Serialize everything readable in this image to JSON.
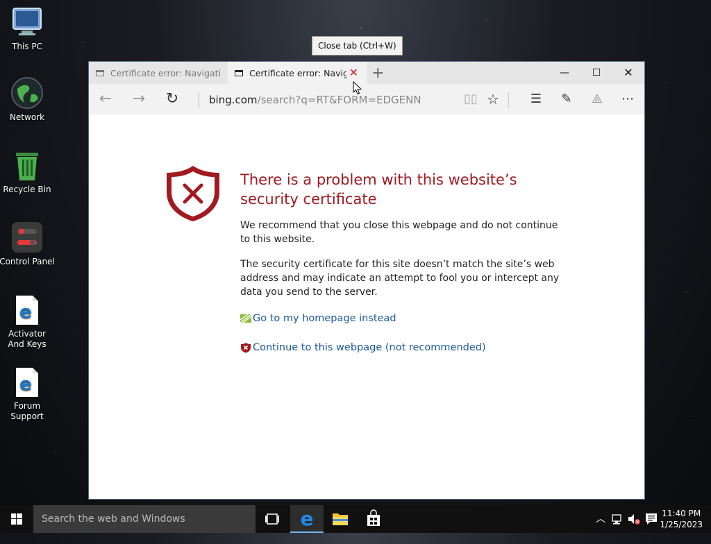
{
  "desktop": {
    "icons": [
      {
        "label": "This PC"
      },
      {
        "label": "Network"
      },
      {
        "label": "Recycle Bin"
      },
      {
        "label": "Control Panel"
      },
      {
        "label": "Activator And Keys"
      },
      {
        "label": "Forum Support"
      }
    ]
  },
  "tooltip": "Close tab (Ctrl+W)",
  "browser": {
    "tabs": [
      {
        "title": "Certificate error: Navigation blocked",
        "active": false
      },
      {
        "title": "Certificate error: Navigation blocked",
        "active": true
      }
    ],
    "address": {
      "domain": "bing.com",
      "path": "/search?q=RT&FORM=EDGENN"
    }
  },
  "error_page": {
    "title": "There is a problem with this website’s security certificate",
    "paragraph1": "We recommend that you close this webpage and do not continue to this website.",
    "paragraph2": "The security certificate for this site doesn’t match the site’s web address and may indicate an attempt to fool you or intercept any data you send to the server.",
    "link_home": "Go to my homepage instead",
    "link_continue": "Continue to this webpage (not recommended)"
  },
  "taskbar": {
    "search_placeholder": "Search the web and Windows",
    "time": "11:40 PM",
    "date": "1/25/2023"
  },
  "colors": {
    "error_red": "#a21920",
    "link_blue": "#1a5a9a",
    "taskbar": "#101010"
  }
}
